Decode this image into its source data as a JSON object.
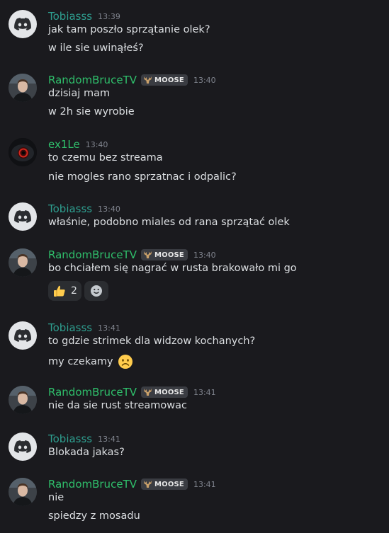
{
  "messages": [
    {
      "author": "Tobiasss",
      "author_color": "#2e9e8f",
      "avatar": "discord-icon",
      "time": "13:39",
      "lines": [
        "jak tam poszło sprzątanie olek?",
        "w ile sie uwinąłeś?"
      ]
    },
    {
      "author": "RandomBruceTV",
      "author_color": "#2fbf6b",
      "avatar": "user-photo",
      "badge": "MOOSE",
      "time": "13:40",
      "lines": [
        "dzisiaj mam",
        "w 2h sie wyrobie"
      ]
    },
    {
      "author": "ex1Le",
      "author_color": "#2fbf6b",
      "avatar": "eye-photo",
      "time": "13:40",
      "lines": [
        "to czemu bez streama",
        "nie mogles rano sprzatnac i odpalic?"
      ]
    },
    {
      "author": "Tobiasss",
      "author_color": "#2e9e8f",
      "avatar": "discord-icon",
      "time": "13:40",
      "lines": [
        "właśnie, podobno miales od rana sprzątać olek"
      ]
    },
    {
      "author": "RandomBruceTV",
      "author_color": "#2fbf6b",
      "avatar": "user-photo",
      "badge": "MOOSE",
      "time": "13:40",
      "lines": [
        "bo chciałem się nagrać w rusta brakowało mi go"
      ],
      "reactions": [
        {
          "emoji": "thumbs-up-icon",
          "count": "2"
        }
      ]
    },
    {
      "author": "Tobiasss",
      "author_color": "#2e9e8f",
      "avatar": "discord-icon",
      "time": "13:41",
      "lines": [
        "to gdzie strimek dla widzow kochanych?",
        "my czekamy"
      ],
      "line2_emoji": "frowning-face-icon"
    },
    {
      "author": "RandomBruceTV",
      "author_color": "#2fbf6b",
      "avatar": "user-photo",
      "badge": "MOOSE",
      "time": "13:41",
      "lines": [
        "nie da sie rust streamowac"
      ]
    },
    {
      "author": "Tobiasss",
      "author_color": "#2e9e8f",
      "avatar": "discord-icon",
      "time": "13:41",
      "lines": [
        "Blokada jakas?"
      ]
    },
    {
      "author": "RandomBruceTV",
      "author_color": "#2fbf6b",
      "avatar": "user-photo",
      "badge": "MOOSE",
      "time": "13:41",
      "lines": [
        "nie",
        "spiedzy z mosadu"
      ]
    }
  ]
}
